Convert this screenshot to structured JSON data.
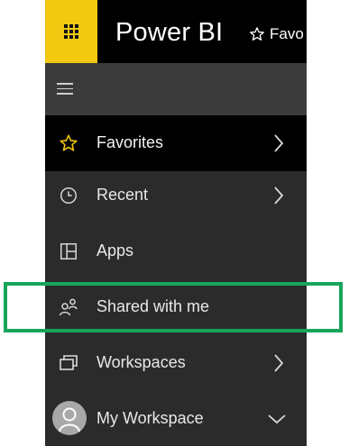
{
  "header": {
    "app_title": "Power BI",
    "favorites_label": "Favo",
    "launcher_icon": "app-launcher-icon",
    "accent_color": "#f2c811"
  },
  "nav": {
    "menu_icon": "hamburger-icon",
    "items": [
      {
        "label": "Favorites",
        "icon": "star-icon",
        "has_chevron": true,
        "active": true
      },
      {
        "label": "Recent",
        "icon": "clock-icon",
        "has_chevron": true,
        "active": false
      },
      {
        "label": "Apps",
        "icon": "apps-icon",
        "has_chevron": false,
        "active": false
      },
      {
        "label": "Shared with me",
        "icon": "shared-people-icon",
        "has_chevron": false,
        "active": false,
        "highlighted": true
      },
      {
        "label": "Workspaces",
        "icon": "workspaces-icon",
        "has_chevron": true,
        "active": false
      },
      {
        "label": "My Workspace",
        "icon": "avatar",
        "has_chevron": true,
        "chevron": "down",
        "active": false
      }
    ]
  },
  "colors": {
    "nav_background": "#2b2b2b",
    "active_background": "#000000",
    "highlight_border": "#18a55b"
  }
}
